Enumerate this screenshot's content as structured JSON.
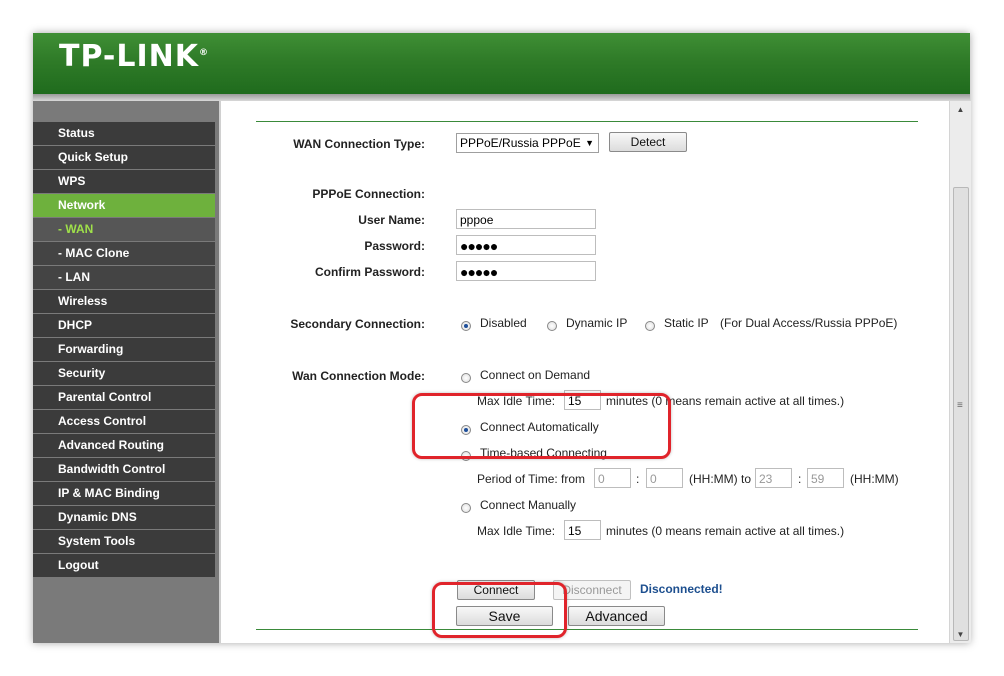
{
  "header": {
    "logo": "TP-LINK",
    "logo_mark": "®"
  },
  "sidebar": {
    "items": [
      {
        "label": "Status"
      },
      {
        "label": "Quick Setup"
      },
      {
        "label": "WPS"
      },
      {
        "label": "Network"
      },
      {
        "label": "- WAN"
      },
      {
        "label": "- MAC Clone"
      },
      {
        "label": "- LAN"
      },
      {
        "label": "Wireless"
      },
      {
        "label": "DHCP"
      },
      {
        "label": "Forwarding"
      },
      {
        "label": "Security"
      },
      {
        "label": "Parental Control"
      },
      {
        "label": "Access Control"
      },
      {
        "label": "Advanced Routing"
      },
      {
        "label": "Bandwidth Control"
      },
      {
        "label": "IP & MAC Binding"
      },
      {
        "label": "Dynamic DNS"
      },
      {
        "label": "System Tools"
      },
      {
        "label": "Logout"
      }
    ],
    "active": "Network",
    "active_sub": "- WAN"
  },
  "form": {
    "wan_type_label": "WAN Connection Type:",
    "wan_type_value": "PPPoE/Russia PPPoE",
    "detect_label": "Detect",
    "pppoe_label": "PPPoE Connection:",
    "user_label": "User Name:",
    "user_value": "pppoe",
    "password_label": "Password:",
    "password_value": "●●●●●",
    "confirm_label": "Confirm Password:",
    "confirm_value": "●●●●●",
    "secondary_label": "Secondary Connection:",
    "secondary_options": {
      "disabled": "Disabled",
      "dynamic": "Dynamic IP",
      "static": "Static IP",
      "note": "(For Dual Access/Russia PPPoE)"
    },
    "mode_label": "Wan Connection Mode:",
    "on_demand": "Connect on Demand",
    "max_idle_label": "Max Idle Time:",
    "max_idle_value": "15",
    "max_idle_note": "minutes (0 means remain active at all times.)",
    "auto": "Connect Automatically",
    "time_based": "Time-based Connecting",
    "period_label": "Period of Time: from",
    "from_hh": "0",
    "from_mm": "0",
    "hhmm_to": "(HH:MM) to",
    "to_hh": "23",
    "to_mm": "59",
    "hhmm": "(HH:MM)",
    "colon": ":",
    "manual": "Connect Manually",
    "manual_idle_label": "Max Idle Time:",
    "manual_idle_value": "15",
    "manual_idle_note": "minutes (0 means remain active at all times.)",
    "connect_label": "Connect",
    "disconnect_label": "Disconnect",
    "status": "Disconnected!",
    "save_label": "Save",
    "advanced_label": "Advanced"
  },
  "scrollbar": {
    "up_icon": "▲",
    "down_icon": "▼",
    "grip": "≡"
  },
  "colors": {
    "header_green": "#2f7b28",
    "menu_active": "#6eb13d",
    "status_blue": "#1d4f8f",
    "highlight_red": "#e0242b"
  }
}
